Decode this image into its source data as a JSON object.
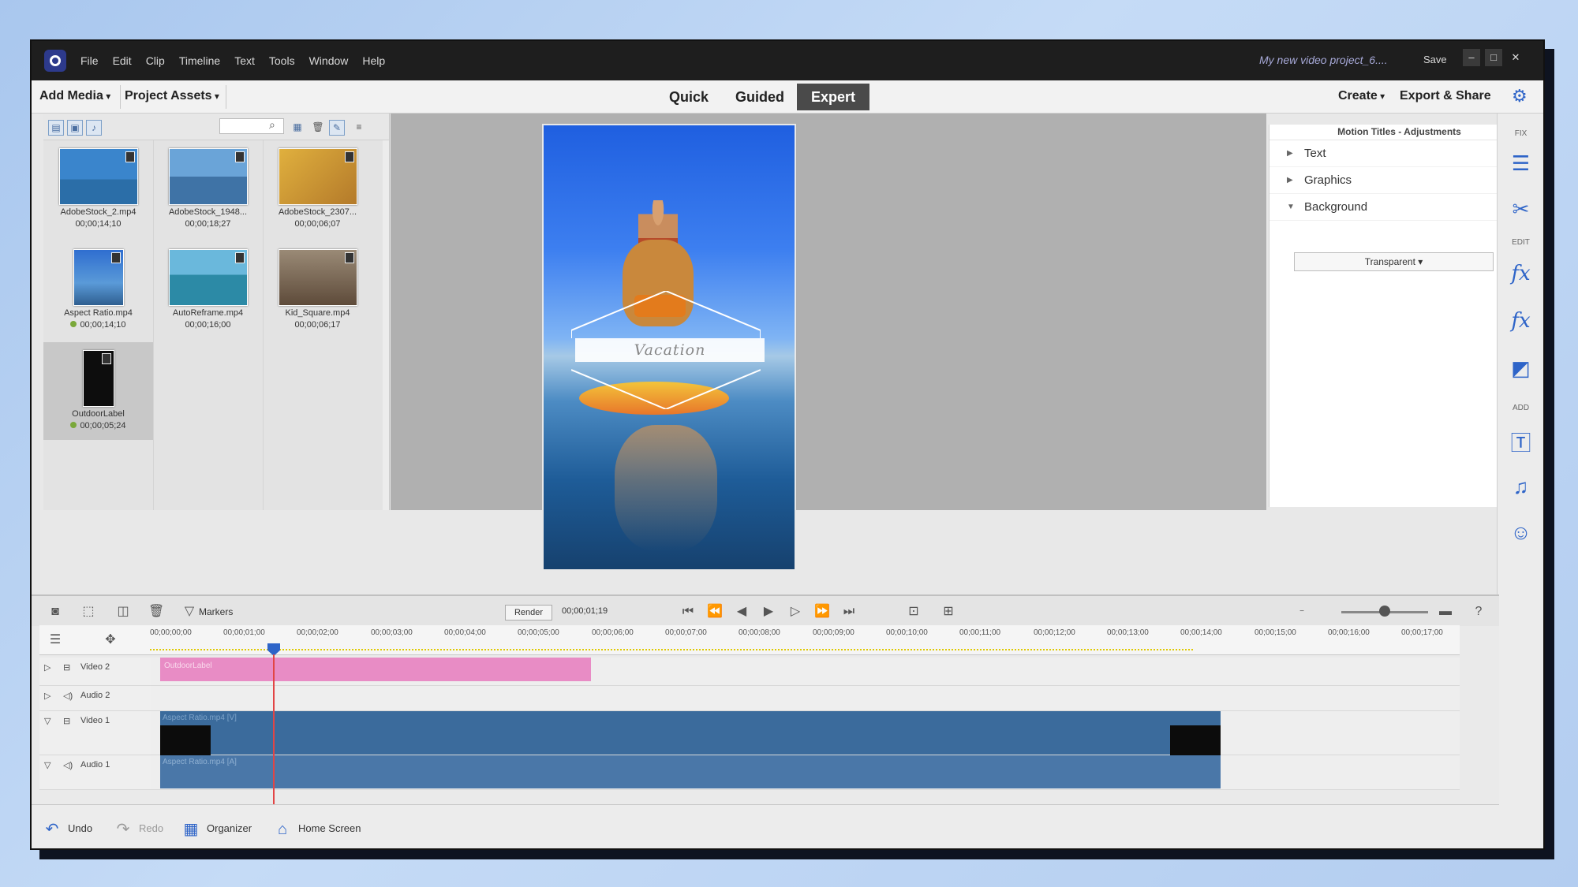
{
  "titlebar": {
    "menu": [
      "File",
      "Edit",
      "Clip",
      "Timeline",
      "Text",
      "Tools",
      "Window",
      "Help"
    ],
    "project_title": "My new video project_6....",
    "save_label": "Save",
    "controls": [
      "–",
      "□",
      "✕"
    ]
  },
  "toolbar": {
    "add_media": "Add Media",
    "project_assets": "Project Assets",
    "modes": [
      "Quick",
      "Guided",
      "Expert"
    ],
    "active_mode": "Expert",
    "create": "Create",
    "export_share": "Export & Share"
  },
  "assets": [
    {
      "name": "AdobeStock_2.mp4",
      "duration": "00;00;14;10",
      "tint": "#3f86c8"
    },
    {
      "name": "AdobeStock_1948...",
      "duration": "00;00;18;27",
      "tint": "#4f8cc2"
    },
    {
      "name": "AdobeStock_2307...",
      "duration": "00;00;06;07",
      "tint": "#d4a33a"
    },
    {
      "name": "Aspect Ratio.mp4",
      "duration": "00;00;14;10",
      "tint": "#3d7ed0"
    },
    {
      "name": "AutoReframe.mp4",
      "duration": "00;00;16;00",
      "tint": "#3e9bb2"
    },
    {
      "name": "Kid_Square.mp4",
      "duration": "00;00;06;17",
      "tint": "#7b6a55"
    },
    {
      "name": "OutdoorLabel",
      "duration": "00;00;05;24",
      "tint": "#111111"
    }
  ],
  "monitor": {
    "title_text": "Vacation"
  },
  "adjustments": {
    "header": "Motion Titles - Adjustments",
    "sections": [
      "Text",
      "Graphics",
      "Background"
    ],
    "background_value": "Transparent"
  },
  "right_panel": {
    "fix": "FIX",
    "edit": "EDIT",
    "add": "ADD"
  },
  "timeline": {
    "markers": "Markers",
    "render": "Render",
    "timecode": "00;00;01;19",
    "ruler": [
      "00;00;00;00",
      "00;00;01;00",
      "00;00;02;00",
      "00;00;03;00",
      "00;00;04;00",
      "00;00;05;00",
      "00;00;06;00",
      "00;00;07;00",
      "00;00;08;00",
      "00;00;09;00",
      "00;00;10;00",
      "00;00;11;00",
      "00;00;12;00",
      "00;00;13;00",
      "00;00;14;00",
      "00;00;15;00",
      "00;00;16;00",
      "00;00;17;00"
    ],
    "tracks": {
      "video2": {
        "label": "Video 2",
        "clip": "OutdoorLabel"
      },
      "audio2": {
        "label": "Audio 2"
      },
      "video1": {
        "label": "Video 1",
        "clip": "Aspect Ratio.mp4 [V]"
      },
      "audio1": {
        "label": "Audio 1",
        "clip": "Aspect Ratio.mp4 [A]"
      }
    },
    "zoom_level": 0.5
  },
  "footer": {
    "undo": "Undo",
    "redo": "Redo",
    "organizer": "Organizer",
    "home": "Home Screen"
  }
}
